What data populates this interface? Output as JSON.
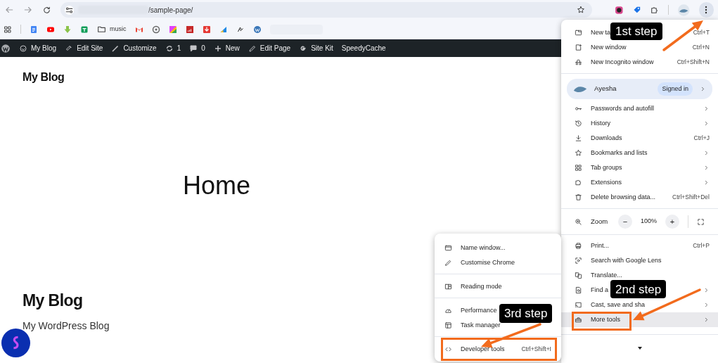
{
  "browser": {
    "url": "/sample-page/",
    "bookmark_folder": "music"
  },
  "admin_bar": [
    {
      "label": "My Blog"
    },
    {
      "label": "Edit Site"
    },
    {
      "label": "Customize"
    },
    {
      "label": "1"
    },
    {
      "label": "0"
    },
    {
      "label": "New"
    },
    {
      "label": "Edit Page"
    },
    {
      "label": "Site Kit"
    },
    {
      "label": "SpeedyCache"
    }
  ],
  "page": {
    "site_title": "My Blog",
    "heading": "Home",
    "footer_title": "My Blog",
    "footer_tagline": "My WordPress Blog"
  },
  "main_menu": {
    "sections": [
      {
        "kind": "items",
        "items": [
          {
            "label": "New ta",
            "shortcut": "Ctrl+T",
            "submenu": false,
            "selected": false
          },
          {
            "label": "New window",
            "shortcut": "Ctrl+N",
            "submenu": false,
            "selected": false
          },
          {
            "label": "New Incognito window",
            "shortcut": "Ctrl+Shift+N",
            "submenu": false,
            "selected": false
          }
        ]
      },
      {
        "kind": "profile",
        "name": "Ayesha",
        "badge": "Signed in"
      },
      {
        "kind": "items",
        "items": [
          {
            "label": "Passwords and autofill",
            "submenu": true,
            "selected": false
          },
          {
            "label": "History",
            "submenu": true,
            "selected": false
          },
          {
            "label": "Downloads",
            "shortcut": "Ctrl+J",
            "submenu": false,
            "selected": false
          },
          {
            "label": "Bookmarks and lists",
            "submenu": true,
            "selected": false
          },
          {
            "label": "Tab groups",
            "submenu": true,
            "selected": false
          },
          {
            "label": "Extensions",
            "submenu": true,
            "selected": false
          },
          {
            "label": "Delete browsing data...",
            "shortcut": "Ctrl+Shift+Del",
            "submenu": false,
            "selected": false
          }
        ]
      },
      {
        "kind": "zoom",
        "label": "Zoom",
        "minus": "−",
        "value": "100%",
        "plus": "+"
      },
      {
        "kind": "items",
        "items": [
          {
            "label": "Print...",
            "shortcut": "Ctrl+P",
            "submenu": false,
            "selected": false
          },
          {
            "label": "Search with Google Lens",
            "submenu": false,
            "selected": false
          },
          {
            "label": "Translate...",
            "submenu": false,
            "selected": false
          },
          {
            "label": "Find a",
            "submenu": true,
            "selected": false
          },
          {
            "label": "Cast, save and sha",
            "submenu": true,
            "selected": false
          },
          {
            "label": "More tools",
            "submenu": true,
            "selected": true
          }
        ]
      }
    ]
  },
  "sub_menu": {
    "sections": [
      {
        "items": [
          {
            "label": "Name window...",
            "selected": false
          },
          {
            "label": "Customise Chrome",
            "selected": false
          }
        ]
      },
      {
        "items": [
          {
            "label": "Reading mode",
            "selected": false
          }
        ]
      },
      {
        "items": [
          {
            "label": "Performance",
            "selected": false
          },
          {
            "label": "Task manager",
            "selected": false
          }
        ]
      },
      {
        "items": [
          {
            "label": "Developer tools",
            "shortcut": "Ctrl+Shift+I",
            "selected": false
          }
        ]
      }
    ]
  },
  "annotations": [
    {
      "text": "1st step"
    },
    {
      "text": "2nd step"
    },
    {
      "text": "3rd step"
    }
  ]
}
